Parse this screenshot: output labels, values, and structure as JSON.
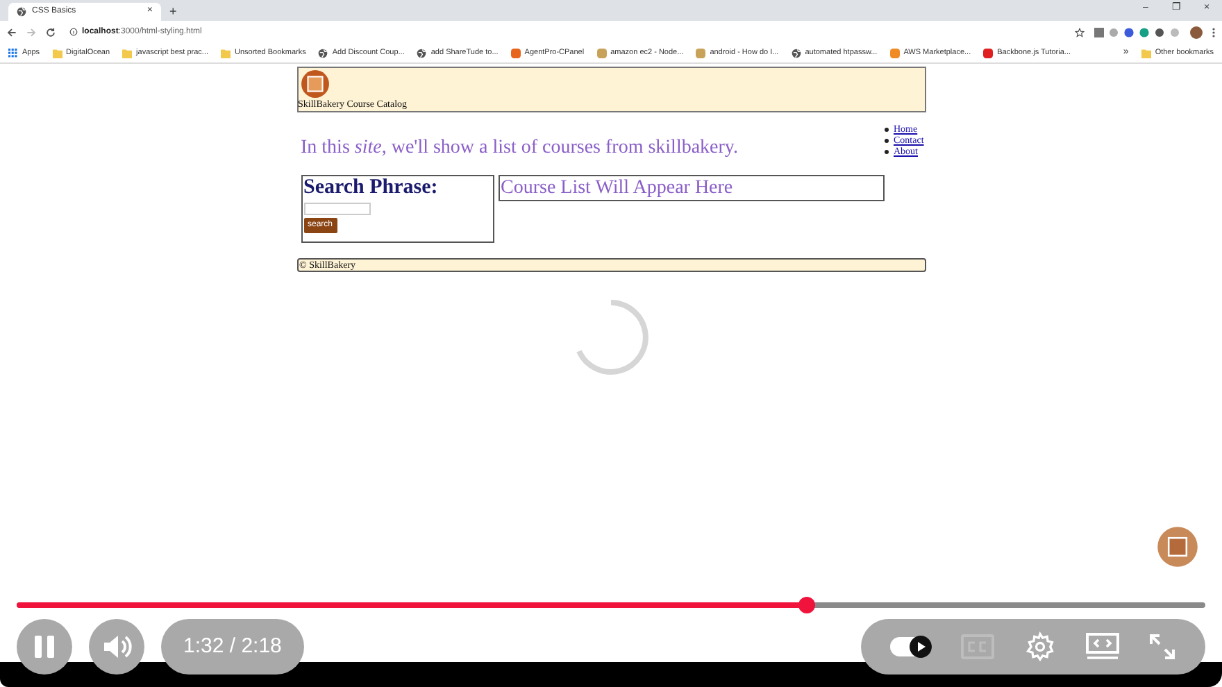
{
  "browser": {
    "tab": {
      "title": "CSS Basics",
      "close": "×"
    },
    "new_tab": "+",
    "window_controls": [
      "–",
      "❐",
      "×"
    ],
    "address": {
      "host": "localhost",
      "path": ":3000/html-styling.html"
    },
    "bookmarks": [
      {
        "kind": "apps",
        "label": "Apps"
      },
      {
        "kind": "folder",
        "label": "DigitalOcean"
      },
      {
        "kind": "folder",
        "label": "javascript best prac..."
      },
      {
        "kind": "folder",
        "label": "Unsorted Bookmarks"
      },
      {
        "kind": "globe",
        "label": "Add Discount Coup..."
      },
      {
        "kind": "globe",
        "label": "add ShareTude to..."
      },
      {
        "kind": "site",
        "color": "#e8631c",
        "label": "AgentPro-CPanel"
      },
      {
        "kind": "site",
        "color": "#c9a25a",
        "label": "amazon ec2 - Node..."
      },
      {
        "kind": "site",
        "color": "#c9a25a",
        "label": "android - How do I..."
      },
      {
        "kind": "globe",
        "label": "automated htpassw..."
      },
      {
        "kind": "site",
        "color": "#f08a24",
        "label": "AWS Marketplace..."
      },
      {
        "kind": "site",
        "color": "#e02020",
        "label": "Backbone.js Tutoria..."
      }
    ],
    "more": "»",
    "other_bookmarks": "Other bookmarks"
  },
  "site": {
    "header_title": "SkillBakery Course Catalog",
    "nav": [
      "Home",
      "Contact",
      "About"
    ],
    "intro": "In this *site*, we'll show a list of courses from skillbakery.",
    "search": {
      "heading": "Search Phrase:",
      "button": "search"
    },
    "course_list": "Course List Will Appear Here",
    "footer": "© SkillBakery"
  },
  "player": {
    "level": 0.665,
    "time": "1:32 / 2:18",
    "playing": true,
    "autoplay": true,
    "captions_disabled": true
  }
}
